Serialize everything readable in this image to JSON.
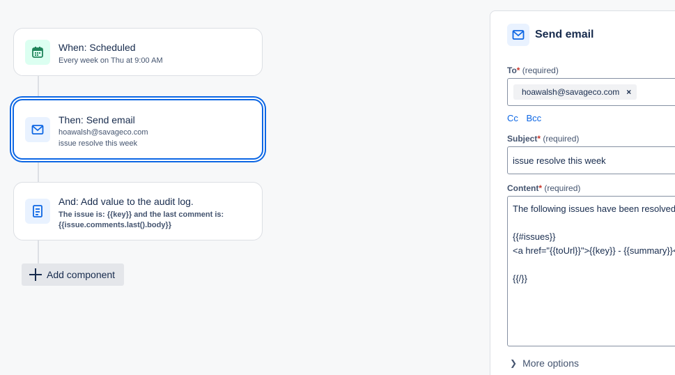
{
  "flow": {
    "trigger": {
      "title": "When: Scheduled",
      "sub": "Every week on Thu at 9:00 AM",
      "icon": "calendar-icon"
    },
    "action": {
      "title": "Then: Send email",
      "sub1": "hoawalsh@savageco.com",
      "sub2": "issue resolve this week",
      "icon": "mail-icon"
    },
    "audit": {
      "title": "And: Add value to the audit log.",
      "sub1": "The issue is: {{key}} and the last comment is:",
      "sub2": "{{issue.comments.last().body}}",
      "icon": "document-icon"
    },
    "add_label": "Add component"
  },
  "panel": {
    "title": "Send email",
    "to": {
      "label": "To",
      "star": "*",
      "req": "(required)",
      "chip": "hoawalsh@savageco.com",
      "remove": "×"
    },
    "cc": "Cc",
    "bcc": "Bcc",
    "subject": {
      "label": "Subject",
      "star": "*",
      "req": "(required)",
      "value": "issue resolve this week"
    },
    "content": {
      "label": "Content",
      "star": "*",
      "req": "(required)",
      "lines": [
        "The following issues have been resolved",
        "",
        "{{#issues}}",
        "<a href=\"{{toUrl}}\">{{key}} - {{summary}}</a>",
        "",
        "{{/}}"
      ]
    },
    "more": "More options"
  },
  "colors": {
    "accent": "#0c66e4",
    "required": "#c9372c",
    "calendar": "#1f845a"
  }
}
